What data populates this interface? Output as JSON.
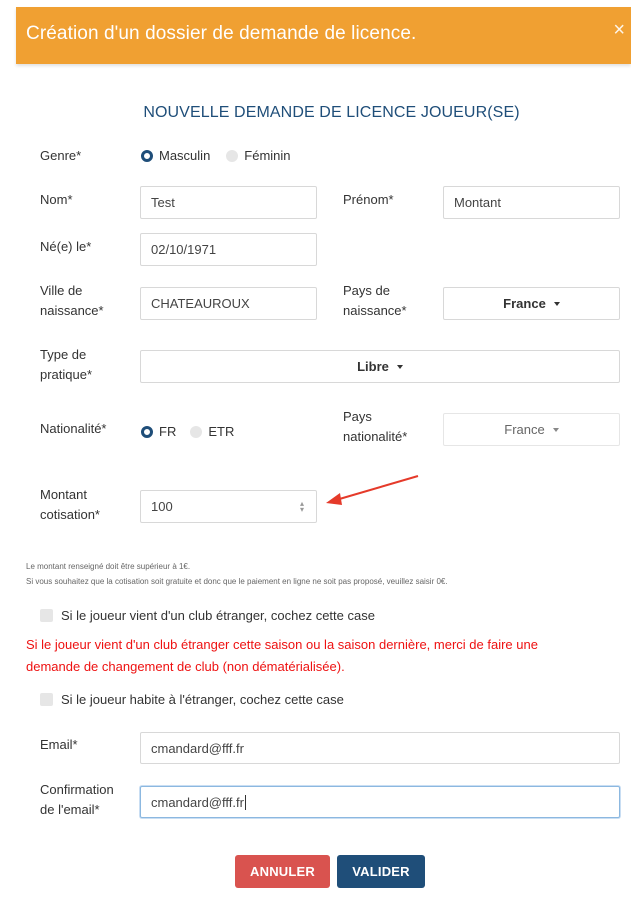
{
  "modal": {
    "title": "Création d'un dossier de demande de licence.",
    "close_label": "×"
  },
  "form": {
    "heading": "NOUVELLE DEMANDE DE LICENCE JOUEUR(SE)",
    "genre": {
      "label": "Genre*",
      "options": [
        "Masculin",
        "Féminin"
      ],
      "selected": "Masculin"
    },
    "nom": {
      "label": "Nom*",
      "value": "Test"
    },
    "prenom": {
      "label": "Prénom*",
      "value": "Montant"
    },
    "naissance": {
      "label": "Né(e) le*",
      "value": "02/10/1971"
    },
    "ville": {
      "label_line1": "Ville de",
      "label_line2": "naissance*",
      "value": "CHATEAUROUX"
    },
    "pays_naissance": {
      "label_line1": "Pays de",
      "label_line2": "naissance*",
      "value": "France"
    },
    "pratique": {
      "label_line1": "Type de",
      "label_line2": "pratique*",
      "value": "Libre"
    },
    "nationalite": {
      "label": "Nationalité*",
      "options": [
        "FR",
        "ETR"
      ],
      "selected": "FR"
    },
    "pays_nationalite": {
      "label_line1": "Pays",
      "label_line2": "nationalité*",
      "value": "France"
    },
    "cotisation": {
      "label_line1": "Montant",
      "label_line2": "cotisation*",
      "value": "100"
    },
    "notes": [
      "Le montant renseigné doit être supérieur à 1€.",
      "Si vous souhaitez que la cotisation soit gratuite et donc que le paiement en ligne ne soit pas proposé, veuillez saisir 0€."
    ],
    "club_etranger_checkbox": "Si le joueur vient d'un club étranger, cochez cette case",
    "warning_line1": "Si le joueur vient d'un club étranger cette saison ou la saison dernière, merci de faire une",
    "warning_line2": "demande de changement de club (non dématérialisée).",
    "habite_etranger_checkbox": "Si le joueur habite à l'étranger, cochez cette case",
    "email": {
      "label": "Email*",
      "value": "cmandard@fff.fr"
    },
    "email_confirm": {
      "label_line1": "Confirmation",
      "label_line2": "de l'email*",
      "value": "cmandard@fff.fr"
    },
    "cancel_label": "ANNULER",
    "validate_label": "VALIDER"
  },
  "colors": {
    "header": "#f0a032",
    "accent": "#1f4e79",
    "danger": "#d9534f",
    "warning_text": "#ee1111",
    "arrow": "#e53a2a"
  }
}
